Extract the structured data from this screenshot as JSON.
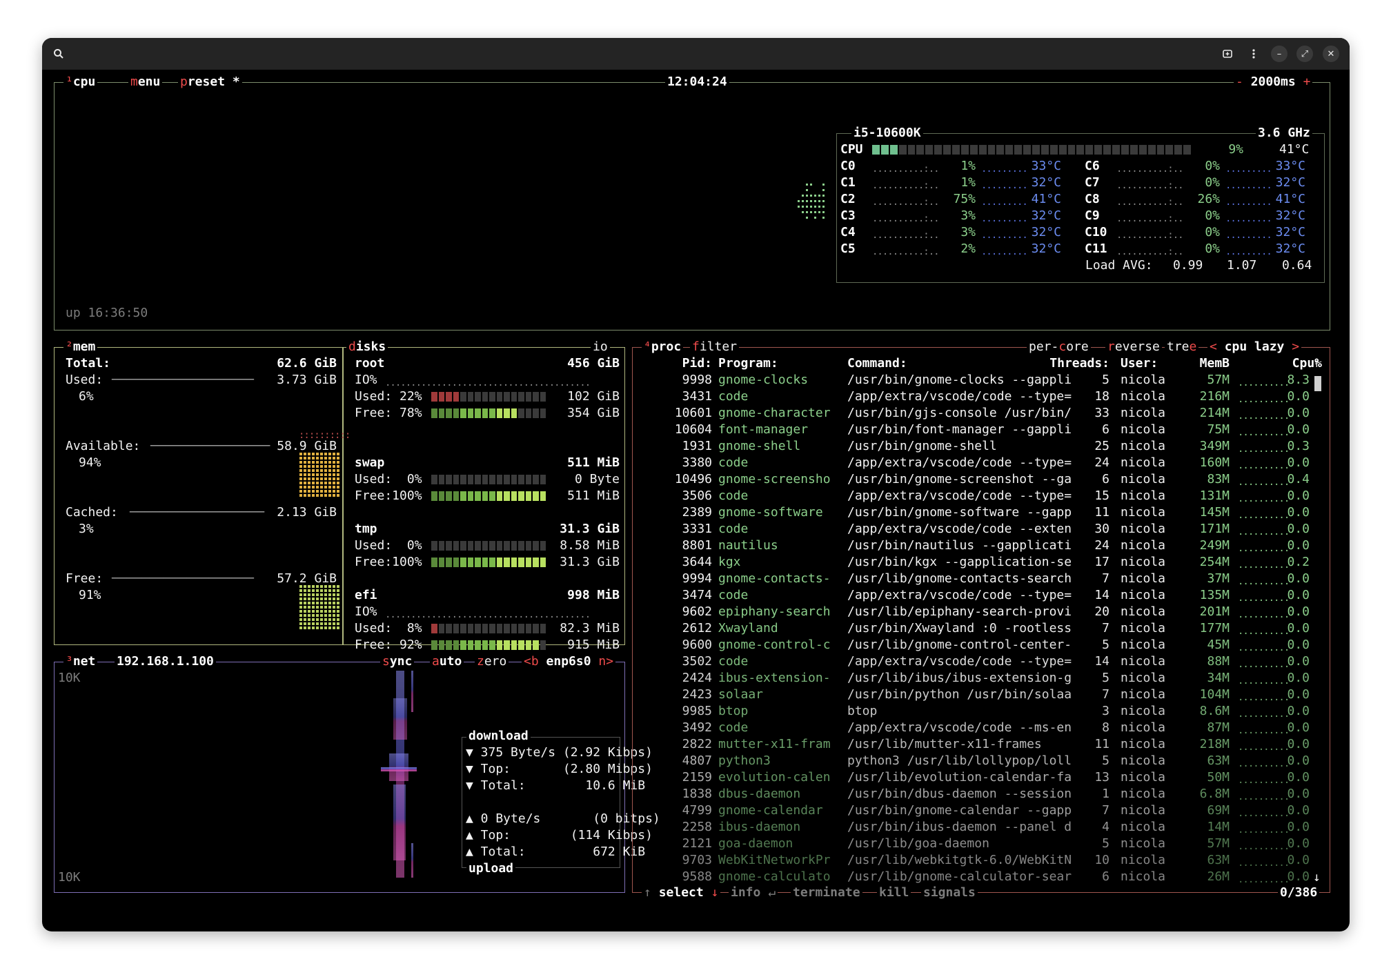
{
  "window": {
    "title": ""
  },
  "cpu": {
    "tabs": {
      "num": "¹",
      "label": "cpu",
      "menu_m": "m",
      "menu_rest": "enu",
      "preset_p": "p",
      "preset_rest": "reset *"
    },
    "clock": "12:04:24",
    "interval_minus": "-",
    "interval": "2000ms",
    "interval_plus": "+",
    "uptime": "up 16:36:50",
    "model": "i5-10600K",
    "freq": "3.6 GHz",
    "total": {
      "label": "CPU",
      "pct": "9%",
      "temp": "41°C",
      "fill": 0.09
    },
    "cores_left": [
      {
        "label": "C0",
        "pct": "1%",
        "temp": "33°C"
      },
      {
        "label": "C1",
        "pct": "1%",
        "temp": "32°C"
      },
      {
        "label": "C2",
        "pct": "75%",
        "temp": "41°C"
      },
      {
        "label": "C3",
        "pct": "3%",
        "temp": "32°C"
      },
      {
        "label": "C4",
        "pct": "3%",
        "temp": "32°C"
      },
      {
        "label": "C5",
        "pct": "2%",
        "temp": "32°C"
      }
    ],
    "cores_right": [
      {
        "label": "C6",
        "pct": "0%",
        "temp": "33°C"
      },
      {
        "label": "C7",
        "pct": "0%",
        "temp": "32°C"
      },
      {
        "label": "C8",
        "pct": "26%",
        "temp": "41°C"
      },
      {
        "label": "C9",
        "pct": "0%",
        "temp": "32°C"
      },
      {
        "label": "C10",
        "pct": "0%",
        "temp": "32°C"
      },
      {
        "label": "C11",
        "pct": "0%",
        "temp": "32°C"
      }
    ],
    "load_label": "Load AVG:",
    "load": [
      "0.99",
      "1.07",
      "0.64"
    ]
  },
  "mem": {
    "tab_num": "²",
    "tab": "mem",
    "total_label": "Total:",
    "total": "62.6 GiB",
    "used_label": "Used:",
    "used": "3.73 GiB",
    "used_pct": "6%",
    "avail_label": "Available:",
    "avail": "58.9 GiB",
    "avail_pct": "94%",
    "cached_label": "Cached:",
    "cached": "2.13 GiB",
    "cached_pct": "3%",
    "free_label": "Free:",
    "free": "57.2 GiB",
    "free_pct": "91%"
  },
  "disks": {
    "tab_d": "d",
    "tab_rest": "isks",
    "io_label": "io",
    "items": [
      {
        "name": "root",
        "size": "456 GiB",
        "io": "IO%",
        "used_label": "Used: 22%",
        "used": "102 GiB",
        "used_fill": 0.22,
        "free_label": "Free: 78%",
        "free": "354 GiB",
        "free_fill": 0.78
      },
      {
        "name": "swap",
        "size": "511 MiB",
        "io": "",
        "used_label": "Used:  0%",
        "used": "0 Byte",
        "used_fill": 0.0,
        "free_label": "Free:100%",
        "free": "511 MiB",
        "free_fill": 1.0
      },
      {
        "name": "tmp",
        "size": "31.3 GiB",
        "io": "",
        "used_label": "Used:  0%",
        "used": "8.58 MiB",
        "used_fill": 0.0,
        "free_label": "Free:100%",
        "free": "31.3 GiB",
        "free_fill": 1.0
      },
      {
        "name": "efi",
        "size": "998 MiB",
        "io": "IO%",
        "used_label": "Used:  8%",
        "used": "82.3 MiB",
        "used_fill": 0.08,
        "free_label": "Free: 92%",
        "free": "915 MiB",
        "free_fill": 0.92
      }
    ]
  },
  "net": {
    "tab_num": "³",
    "tab": "net",
    "ip": "192.168.1.100",
    "sync_s": "s",
    "sync_rest": "ync",
    "auto_a": "a",
    "auto_rest": "uto",
    "zero_z": "z",
    "zero_rest": "ero",
    "b_key": "<b",
    "iface": "enp6s0",
    "n_key": "n>",
    "scale_top": "10K",
    "scale_bottom": "10K",
    "download_title": "download",
    "dl_rate": "▼ 375 Byte/s (2.92 Kibps)",
    "dl_top": "▼ Top:       (2.80 Mibps)",
    "dl_total": "▼ Total:        10.6 MiB",
    "ul_rate": "▲ 0 Byte/s       (0 bitps)",
    "ul_top": "▲ Top:        (114 Kibps)",
    "ul_total": "▲ Total:         672 KiB",
    "upload_title": "upload"
  },
  "proc": {
    "tab_num": "⁴",
    "tab": "proc",
    "filter_f": "f",
    "filter_rest": "ilter",
    "percore_a": "per-",
    "percore_c": "c",
    "percore_b": "ore",
    "reverse_r": "r",
    "reverse_rest": "everse",
    "tree_a": "tre",
    "tree_e": "e",
    "sort_left": "<",
    "sort": "cpu lazy",
    "sort_right": ">",
    "headers": {
      "pid": "Pid:",
      "program": "Program:",
      "command": "Command:",
      "threads": "Threads:",
      "user": "User:",
      "mem": "MemB",
      "cpu": "Cpu%"
    },
    "rows": [
      [
        "9998",
        "gnome-clocks",
        "/usr/bin/gnome-clocks --gappli",
        "5",
        "nicola",
        "57M",
        "8.3"
      ],
      [
        "3431",
        "code",
        "/app/extra/vscode/code --type=",
        "18",
        "nicola",
        "216M",
        "0.0"
      ],
      [
        "10601",
        "gnome-character",
        "/usr/bin/gjs-console /usr/bin/",
        "33",
        "nicola",
        "214M",
        "0.0"
      ],
      [
        "10604",
        "font-manager",
        "/usr/bin/font-manager --gappli",
        "6",
        "nicola",
        "75M",
        "0.0"
      ],
      [
        "1931",
        "gnome-shell",
        "/usr/bin/gnome-shell",
        "25",
        "nicola",
        "349M",
        "0.3"
      ],
      [
        "3380",
        "code",
        "/app/extra/vscode/code --type=",
        "24",
        "nicola",
        "160M",
        "0.0"
      ],
      [
        "10496",
        "gnome-screensho",
        "/usr/bin/gnome-screenshot --ga",
        "6",
        "nicola",
        "83M",
        "0.4"
      ],
      [
        "3506",
        "code",
        "/app/extra/vscode/code --type=",
        "15",
        "nicola",
        "131M",
        "0.0"
      ],
      [
        "2389",
        "gnome-software",
        "/usr/bin/gnome-software --gapp",
        "11",
        "nicola",
        "145M",
        "0.0"
      ],
      [
        "3331",
        "code",
        "/app/extra/vscode/code --exten",
        "30",
        "nicola",
        "171M",
        "0.0"
      ],
      [
        "8801",
        "nautilus",
        "/usr/bin/nautilus --gapplicati",
        "24",
        "nicola",
        "249M",
        "0.0"
      ],
      [
        "3644",
        "kgx",
        "/usr/bin/kgx --gapplication-se",
        "17",
        "nicola",
        "254M",
        "0.2"
      ],
      [
        "9994",
        "gnome-contacts-",
        "/usr/lib/gnome-contacts-search",
        "7",
        "nicola",
        "37M",
        "0.0"
      ],
      [
        "3474",
        "code",
        "/app/extra/vscode/code --type=",
        "14",
        "nicola",
        "135M",
        "0.0"
      ],
      [
        "9602",
        "epiphany-search",
        "/usr/lib/epiphany-search-provi",
        "20",
        "nicola",
        "201M",
        "0.0"
      ],
      [
        "2612",
        "Xwayland",
        "/usr/bin/Xwayland :0 -rootless",
        "7",
        "nicola",
        "177M",
        "0.0"
      ],
      [
        "9600",
        "gnome-control-c",
        "/usr/lib/gnome-control-center-",
        "5",
        "nicola",
        "45M",
        "0.0"
      ],
      [
        "3502",
        "code",
        "/app/extra/vscode/code --type=",
        "14",
        "nicola",
        "88M",
        "0.0"
      ],
      [
        "2424",
        "ibus-extension-",
        "/usr/lib/ibus/ibus-extension-g",
        "5",
        "nicola",
        "34M",
        "0.0"
      ],
      [
        "2423",
        "solaar",
        "/usr/bin/python /usr/bin/solaa",
        "7",
        "nicola",
        "104M",
        "0.0"
      ],
      [
        "9985",
        "btop",
        "btop",
        "3",
        "nicola",
        "8.6M",
        "0.0"
      ],
      [
        "3492",
        "code",
        "/app/extra/vscode/code --ms-en",
        "8",
        "nicola",
        "87M",
        "0.0"
      ],
      [
        "2822",
        "mutter-x11-fram",
        "/usr/lib/mutter-x11-frames",
        "11",
        "nicola",
        "218M",
        "0.0"
      ],
      [
        "4807",
        "python3",
        "python3 /usr/lib/lollypop/loll",
        "5",
        "nicola",
        "63M",
        "0.0"
      ],
      [
        "2159",
        "evolution-calen",
        "/usr/lib/evolution-calendar-fa",
        "13",
        "nicola",
        "50M",
        "0.0"
      ],
      [
        "1838",
        "dbus-daemon",
        "/usr/bin/dbus-daemon --session",
        "1",
        "nicola",
        "6.8M",
        "0.0"
      ],
      [
        "4799",
        "gnome-calendar",
        "/usr/bin/gnome-calendar --gapp",
        "7",
        "nicola",
        "69M",
        "0.0"
      ],
      [
        "2258",
        "ibus-daemon",
        "/usr/bin/ibus-daemon --panel d",
        "4",
        "nicola",
        "14M",
        "0.0"
      ],
      [
        "2121",
        "goa-daemon",
        "/usr/lib/goa-daemon",
        "5",
        "nicola",
        "57M",
        "0.0"
      ],
      [
        "9703",
        "WebKitNetworkPr",
        "/usr/lib/webkitgtk-6.0/WebKitN",
        "10",
        "nicola",
        "63M",
        "0.0"
      ],
      [
        "9588",
        "gnome-calculato",
        "/usr/lib/gnome-calculator-sear",
        "6",
        "nicola",
        "26M",
        "0.0"
      ]
    ],
    "footer": {
      "select_up": "↑",
      "select": "select",
      "select_down": "↓",
      "info": "info",
      "info_key": "↵",
      "terminate": "terminate",
      "kill": "kill",
      "signals": "signals",
      "count": "0/386"
    }
  }
}
